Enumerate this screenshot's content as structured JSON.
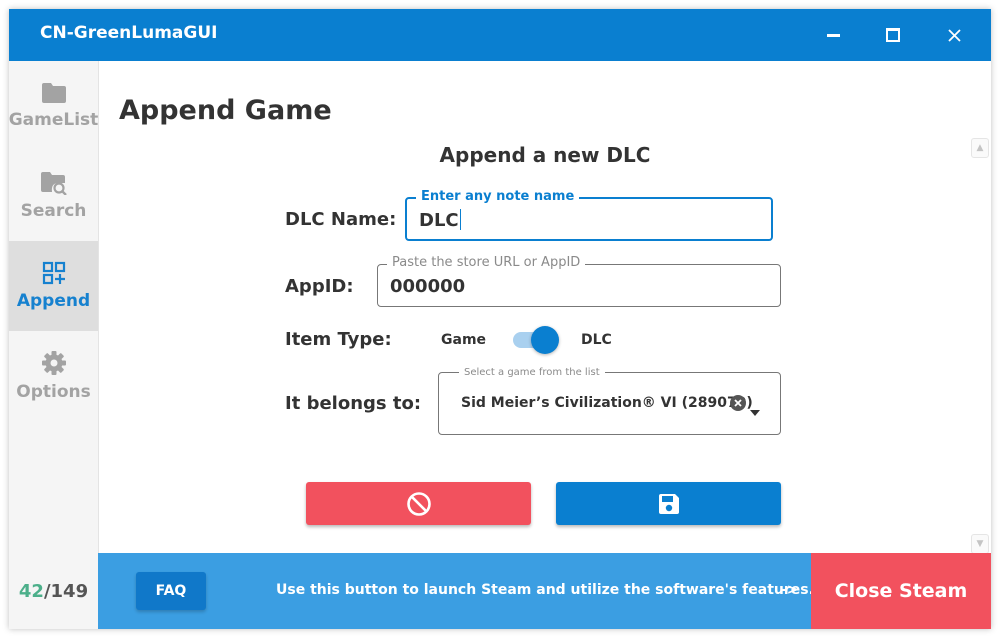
{
  "window": {
    "title": "CN-GreenLumaGUI",
    "minimize_icon": "minimize-icon",
    "maximize_icon": "maximize-icon",
    "close_icon": "close-icon"
  },
  "sidebar": {
    "items": [
      {
        "label": "GameList",
        "icon": "folder-icon",
        "active": false
      },
      {
        "label": "Search",
        "icon": "folder-search-icon",
        "active": false
      },
      {
        "label": "Append",
        "icon": "grid-plus-icon",
        "active": true
      },
      {
        "label": "Options",
        "icon": "gear-icon",
        "active": false
      }
    ]
  },
  "page": {
    "title": "Append Game",
    "section_title": "Append a new DLC"
  },
  "form": {
    "dlc_name": {
      "label": "DLC Name:",
      "legend": "Enter any note name",
      "value": "DLC"
    },
    "appid": {
      "label": "AppID:",
      "legend": "Paste the store URL or AppID",
      "value": "000000"
    },
    "item_type": {
      "label": "Item Type:",
      "left_option": "Game",
      "right_option": "DLC",
      "selected": "DLC"
    },
    "belongs_to": {
      "label": "It belongs to:",
      "legend": "Select a game from the list",
      "value": "Sid Meier’s Civilization® VI (289070)"
    }
  },
  "buttons": {
    "cancel_icon": "cancel-icon",
    "save_icon": "floppy-disk-icon"
  },
  "footer": {
    "count_current": "42",
    "count_sep": "/",
    "count_total": "149",
    "faq_label": "FAQ",
    "message": "Use this button to launch Steam and utilize the software's features.",
    "arrow": "->",
    "close_steam_label": "Close Steam"
  },
  "colors": {
    "accent": "#0a7fd0",
    "danger": "#f2515e",
    "footer_bar": "#3b9ee2",
    "count_current": "#4caf8a"
  }
}
